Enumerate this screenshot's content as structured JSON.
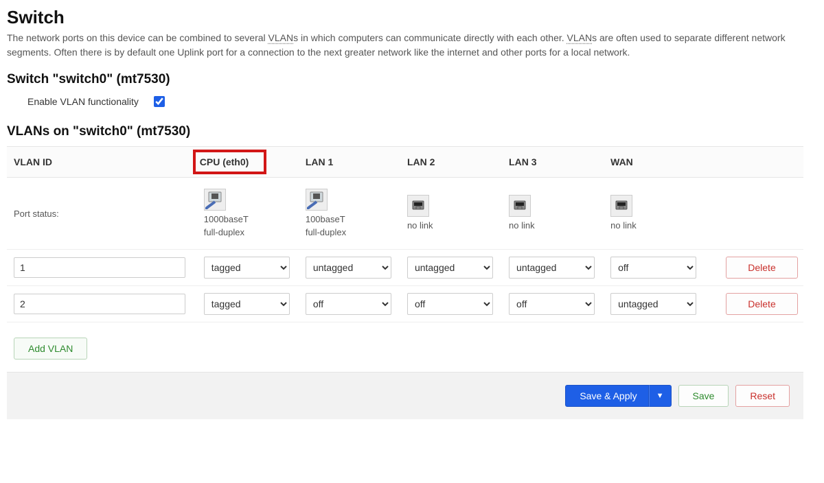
{
  "page": {
    "title": "Switch",
    "description_parts": {
      "p0": "The network ports on this device can be combined to several ",
      "abbr_vlans": "VLAN",
      "p1": "s in which computers can communicate directly with each other. ",
      "p2": "s are often used to separate different network segments. Often there is by default one Uplink port for a connection to the next greater network like the internet and other ports for a local network."
    }
  },
  "switch_section": {
    "heading": "Switch \"switch0\" (mt7530)",
    "enable_label": "Enable VLAN functionality",
    "enable_checked": true
  },
  "vlans_section": {
    "heading": "VLANs on \"switch0\" (mt7530)",
    "columns": {
      "vlan_id": "VLAN ID",
      "cpu": "CPU (eth0)",
      "lan1": "LAN 1",
      "lan2": "LAN 2",
      "lan3": "LAN 3",
      "wan": "WAN"
    },
    "port_status_label": "Port status:",
    "port_status": {
      "cpu": {
        "icon": "rj45-cable",
        "line1": "1000baseT",
        "line2": "full-duplex"
      },
      "lan1": {
        "icon": "rj45-cable",
        "line1": "100baseT",
        "line2": "full-duplex"
      },
      "lan2": {
        "icon": "rj45-empty",
        "line1": "no link",
        "line2": ""
      },
      "lan3": {
        "icon": "rj45-empty",
        "line1": "no link",
        "line2": ""
      },
      "wan": {
        "icon": "rj45-empty",
        "line1": "no link",
        "line2": ""
      }
    },
    "select_options": [
      "tagged",
      "untagged",
      "off"
    ],
    "rows": [
      {
        "id": "1",
        "cpu": "tagged",
        "lan1": "untagged",
        "lan2": "untagged",
        "lan3": "untagged",
        "wan": "off"
      },
      {
        "id": "2",
        "cpu": "tagged",
        "lan1": "off",
        "lan2": "off",
        "lan3": "off",
        "wan": "untagged"
      }
    ],
    "delete_label": "Delete",
    "add_vlan_label": "Add VLAN"
  },
  "footer": {
    "save_apply": "Save & Apply",
    "save": "Save",
    "reset": "Reset"
  }
}
